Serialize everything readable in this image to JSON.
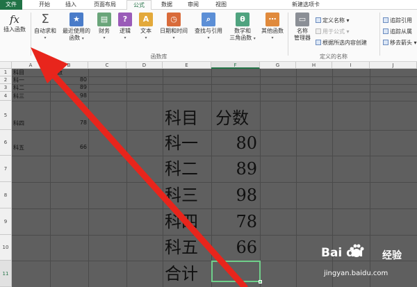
{
  "tabs": [
    "文件",
    "开始",
    "插入",
    "页面布局",
    "公式",
    "数据",
    "审阅",
    "视图",
    "新建选项卡"
  ],
  "ribbon": {
    "insert_function": "插入函数",
    "autosum": "自动求和",
    "recent_line1": "最近使用的",
    "recent_line2": "函数",
    "financial": "财务",
    "logical": "逻辑",
    "text": "文本",
    "datetime": "日期和时间",
    "lookup": "查找与引用",
    "math_line1": "数学和",
    "math_line2": "三角函数",
    "more": "其他函数",
    "library_label": "函数库",
    "name_mgr_line1": "名称",
    "name_mgr_line2": "管理器",
    "define_name": "定义名称",
    "use_in_formula": "用于公式",
    "create_from_sel": "根据所选内容创建",
    "defined_names_label": "定义的名称",
    "trace_precedents": "追踪引用",
    "trace_dependents": "追踪从属",
    "remove_arrows": "移去箭头"
  },
  "columns": [
    "A",
    "B",
    "C",
    "D",
    "E",
    "F",
    "G",
    "H",
    "I",
    "J"
  ],
  "rows": [
    "1",
    "2",
    "3",
    "4",
    "5",
    "6",
    "7",
    "8",
    "9",
    "10",
    "11"
  ],
  "small_table": {
    "header": [
      "科目",
      "分数"
    ],
    "rows": [
      [
        "科一",
        "80"
      ],
      [
        "科二",
        "89"
      ],
      [
        "科三",
        "98"
      ],
      [
        "科四",
        "78"
      ],
      [
        "科五",
        "66"
      ]
    ]
  },
  "big_table": {
    "header": [
      "科目",
      "分数"
    ],
    "rows": [
      [
        "科一",
        "80"
      ],
      [
        "科二",
        "89"
      ],
      [
        "科三",
        "98"
      ],
      [
        "科四",
        "78"
      ],
      [
        "科五",
        "66"
      ]
    ],
    "total_label": "合计",
    "total_value": ""
  },
  "watermark": {
    "logo": "Bai du",
    "sub": "经验",
    "url": "jingyan.baidu.com"
  },
  "colors": {
    "file_tab": "#217346",
    "accent": "#217346",
    "arrow": "#e8251c",
    "selection": "#6fcf8a",
    "sheet_bg": "#5f5f5f"
  }
}
